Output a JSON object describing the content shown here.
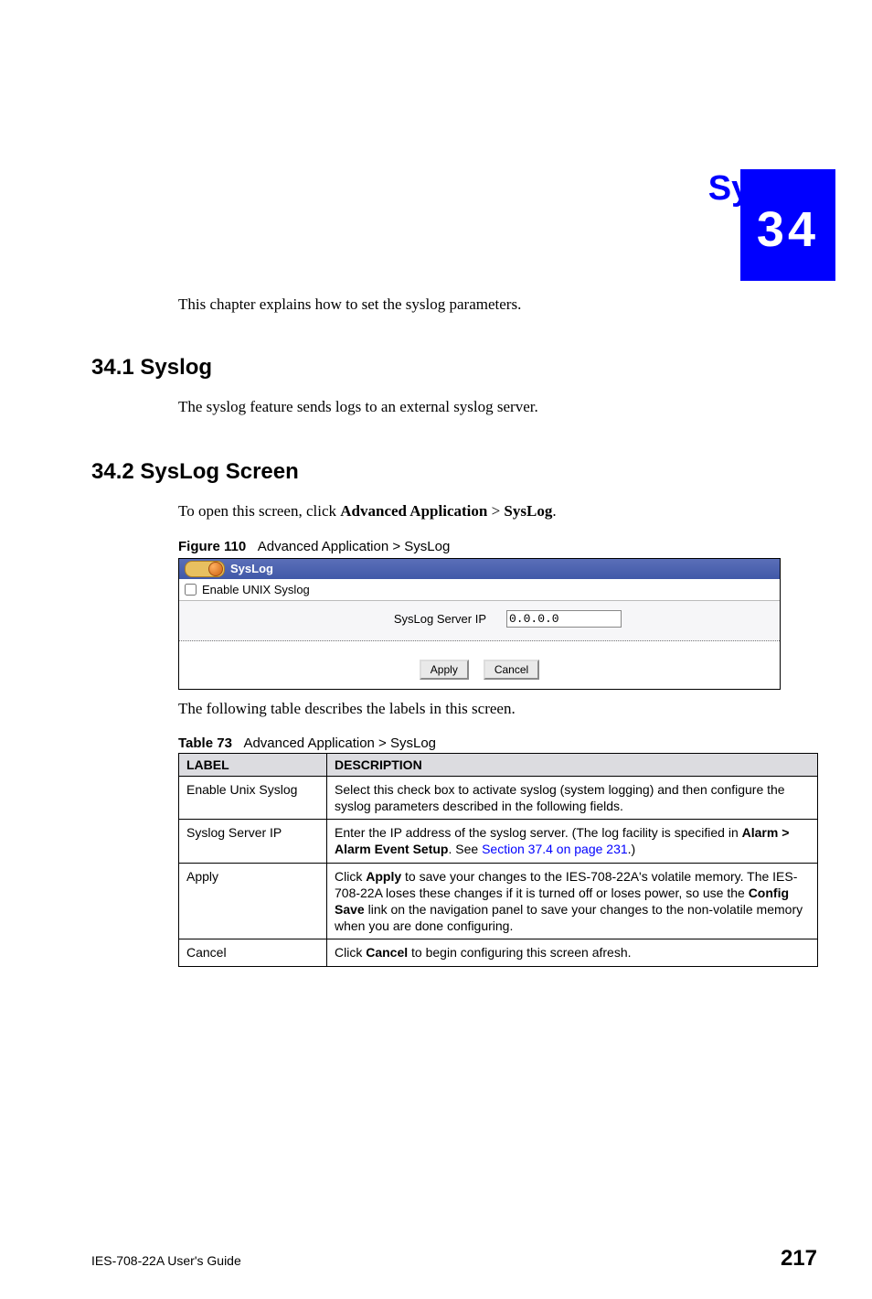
{
  "chapter": {
    "number": "34",
    "title": "SysLog"
  },
  "intro": "This chapter explains how to set the syslog parameters.",
  "sections": {
    "s1": {
      "heading": "34.1  Syslog",
      "body": "The syslog feature sends logs to an external syslog server."
    },
    "s2": {
      "heading": "34.2  SysLog Screen",
      "body_prefix": "To open this screen, click ",
      "body_link1": "Advanced Application",
      "body_mid": " > ",
      "body_link2": "SysLog",
      "body_suffix": "."
    }
  },
  "figure": {
    "caption_prefix": "Figure 110",
    "caption_text": "Advanced Application > SysLog",
    "titlebar": "SysLog",
    "enable_label": "Enable UNIX Syslog",
    "ip_label": "SysLog Server IP",
    "ip_value": "0.0.0.0",
    "apply_btn": "Apply",
    "cancel_btn": "Cancel"
  },
  "post_figure": "The following table describes the labels in this screen.",
  "table": {
    "caption_prefix": "Table 73",
    "caption_text": "Advanced Application > SysLog",
    "headers": {
      "label": "LABEL",
      "desc": "DESCRIPTION"
    },
    "rows": {
      "r1": {
        "label": "Enable Unix Syslog",
        "desc": "Select this check box to activate syslog (system logging) and then configure the syslog parameters described in the following fields."
      },
      "r2": {
        "label": "Syslog Server IP",
        "desc_pre": "Enter the IP address of the syslog server. (The log facility is specified in ",
        "bold1": "Alarm > Alarm Event Setup",
        "mid": ". See ",
        "link": "Section 37.4 on page 231",
        "suf": ".)"
      },
      "r3": {
        "label": "Apply",
        "pre": "Click ",
        "b1": "Apply",
        "t1": " to save your changes to the IES-708-22A's volatile memory. The IES-708-22A loses these changes if it is turned off or loses power, so use the ",
        "b2": "Config Save",
        "t2": " link on the navigation panel to save your changes to the non-volatile memory when you are done configuring."
      },
      "r4": {
        "label": "Cancel",
        "pre": "Click ",
        "b1": "Cancel",
        "suf": " to begin configuring this screen afresh."
      }
    }
  },
  "footer": {
    "guide": "IES-708-22A User's Guide",
    "page": "217"
  }
}
